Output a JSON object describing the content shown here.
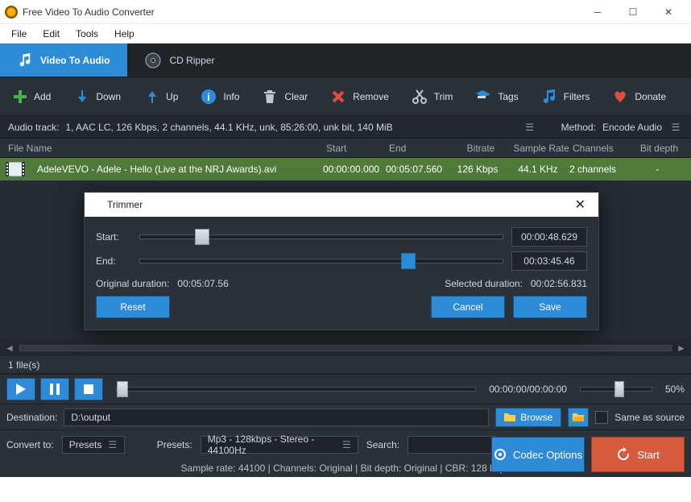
{
  "window": {
    "title": "Free Video To Audio Converter"
  },
  "menu": {
    "file": "File",
    "edit": "Edit",
    "tools": "Tools",
    "help": "Help"
  },
  "tabs": {
    "video": "Video To Audio",
    "cd": "CD Ripper"
  },
  "toolbar": {
    "add": "Add",
    "down": "Down",
    "up": "Up",
    "info": "Info",
    "clear": "Clear",
    "remove": "Remove",
    "trim": "Trim",
    "tags": "Tags",
    "filters": "Filters",
    "donate": "Donate"
  },
  "track": {
    "label": "Audio track:",
    "value": "1, AAC LC, 126 Kbps, 2 channels, 44.1 KHz, unk, 85:26:00, unk bit, 140 MiB",
    "method_label": "Method:",
    "method_value": "Encode Audio"
  },
  "columns": {
    "file": "File Name",
    "start": "Start",
    "end": "End",
    "bitrate": "Bitrate",
    "samplerate": "Sample Rate",
    "channels": "Channels",
    "bitdepth": "Bit depth"
  },
  "row": {
    "file": "AdeleVEVO - Adele - Hello (Live at the NRJ Awards).avi",
    "start": "00:00:00.000",
    "end": "00:05:07.560",
    "bitrate": "126 Kbps",
    "samplerate": "44.1 KHz",
    "channels": "2 channels",
    "bitdepth": "-"
  },
  "trimmer": {
    "title": "Trimmer",
    "start_label": "Start:",
    "start_value": "00:00:48.629",
    "end_label": "End:",
    "end_value": "00:03:45.46",
    "orig_label": "Original duration:",
    "orig_value": "00:05:07.56",
    "sel_label": "Selected duration:",
    "sel_value": "00:02:56.831",
    "reset": "Reset",
    "cancel": "Cancel",
    "save": "Save"
  },
  "filecount": "1 file(s)",
  "player": {
    "time": "00:00:00/00:00:00",
    "vol": "50%"
  },
  "dest": {
    "label": "Destination:",
    "value": "D:\\output",
    "browse": "Browse",
    "same": "Same as source"
  },
  "convert": {
    "label": "Convert to:",
    "presets_sel": "Presets",
    "presets_label": "Presets:",
    "preset_value": "Mp3 - 128kbps - Stereo - 44100Hz",
    "search_label": "Search:"
  },
  "info_line": "Sample rate: 44100 | Channels: Original | Bit depth: Original | CBR: 128 kbps",
  "actions": {
    "codec": "Codec Options",
    "start": "Start"
  }
}
